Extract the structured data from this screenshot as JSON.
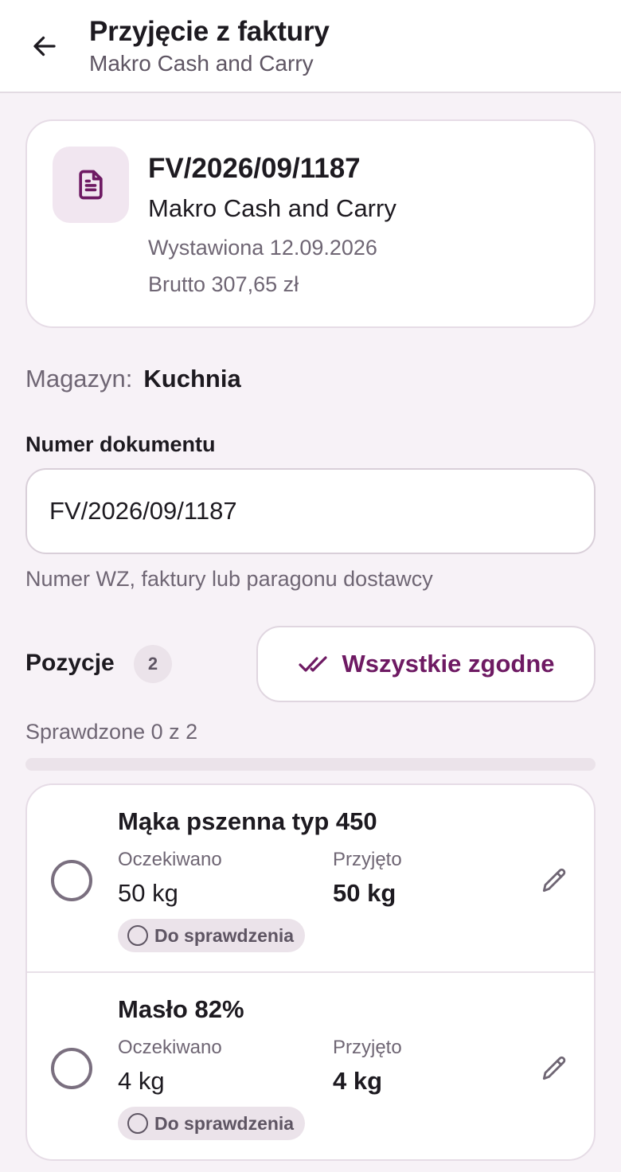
{
  "appbar": {
    "title": "Przyjęcie z faktury",
    "subtitle": "Makro Cash and Carry"
  },
  "invoice": {
    "number": "FV/2026/09/1187",
    "supplier": "Makro Cash and Carry",
    "issued": "Wystawiona 12.09.2026",
    "gross": "Brutto 307,65 zł",
    "icon": "document-icon"
  },
  "warehouse": {
    "label": "Magazyn:",
    "value": "Kuchnia"
  },
  "document_field": {
    "label": "Numer dokumentu",
    "value": "FV/2026/09/1187",
    "hint": "Numer WZ, faktury lub paragonu dostawcy"
  },
  "positions": {
    "title": "Pozycje",
    "count": "2",
    "all_ok_label": "Wszystkie zgodne",
    "checked_text": "Sprawdzone 0 z 2",
    "progress_fraction": 0,
    "items": [
      {
        "name": "Mąka pszenna typ 450",
        "expected_label": "Oczekiwano",
        "expected": "50 kg",
        "received_label": "Przyjęto",
        "received": "50 kg",
        "status": "Do sprawdzenia"
      },
      {
        "name": "Masło 82%",
        "expected_label": "Oczekiwano",
        "expected": "4 kg",
        "received_label": "Przyjęto",
        "received": "4 kg",
        "status": "Do sprawdzenia"
      }
    ]
  },
  "colors": {
    "accent": "#6e1a63",
    "background": "#f7f2f7",
    "card": "#ffffff",
    "muted_text": "#6f6674"
  }
}
